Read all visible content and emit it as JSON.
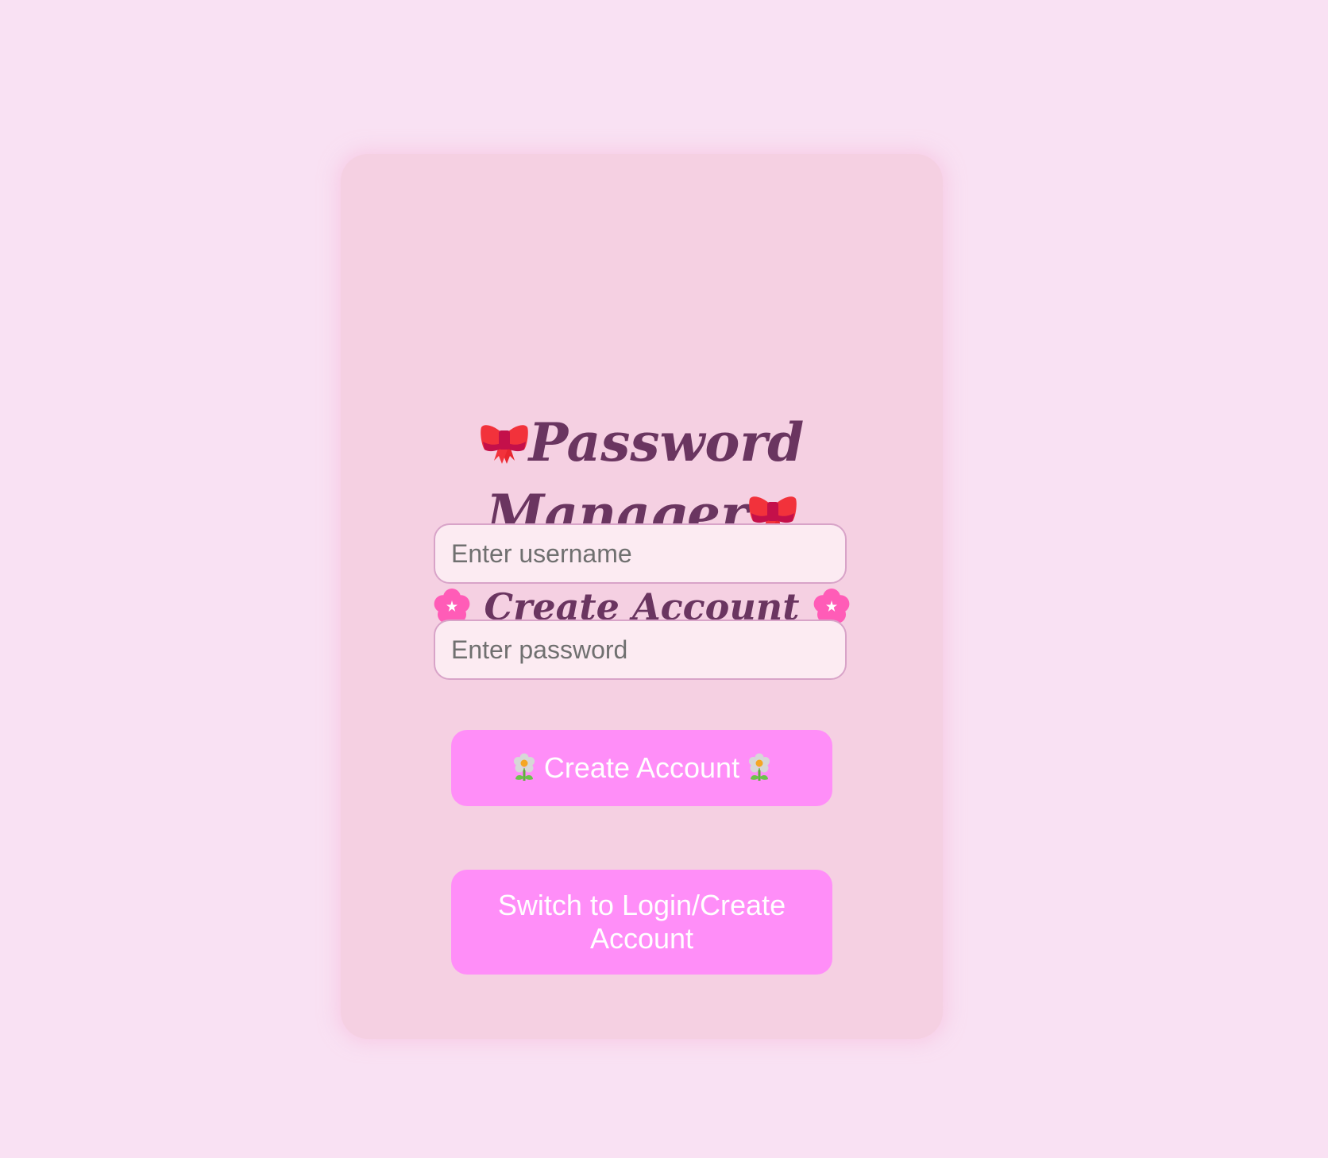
{
  "app": {
    "title": "Password Manager",
    "subtitle": "Create Account"
  },
  "form": {
    "username": {
      "value": "",
      "placeholder": "Enter username"
    },
    "password": {
      "value": "",
      "placeholder": "Enter password"
    }
  },
  "buttons": {
    "create_label": "Create Account",
    "switch_label": "Switch to Login/Create Account"
  },
  "icons": {
    "title_decoration": "ribbon-bow-icon",
    "subtitle_decoration": "cherry-blossom-icon",
    "button_decoration": "daisy-icon"
  },
  "colors": {
    "page_background": "#f9e1f3",
    "card_background": "#f5d0e2",
    "heading_text": "#6a3560",
    "button_background": "#ff8ef8",
    "button_text": "#ffffff",
    "input_border": "#d8a3c8",
    "input_background": "#fcebf2"
  }
}
